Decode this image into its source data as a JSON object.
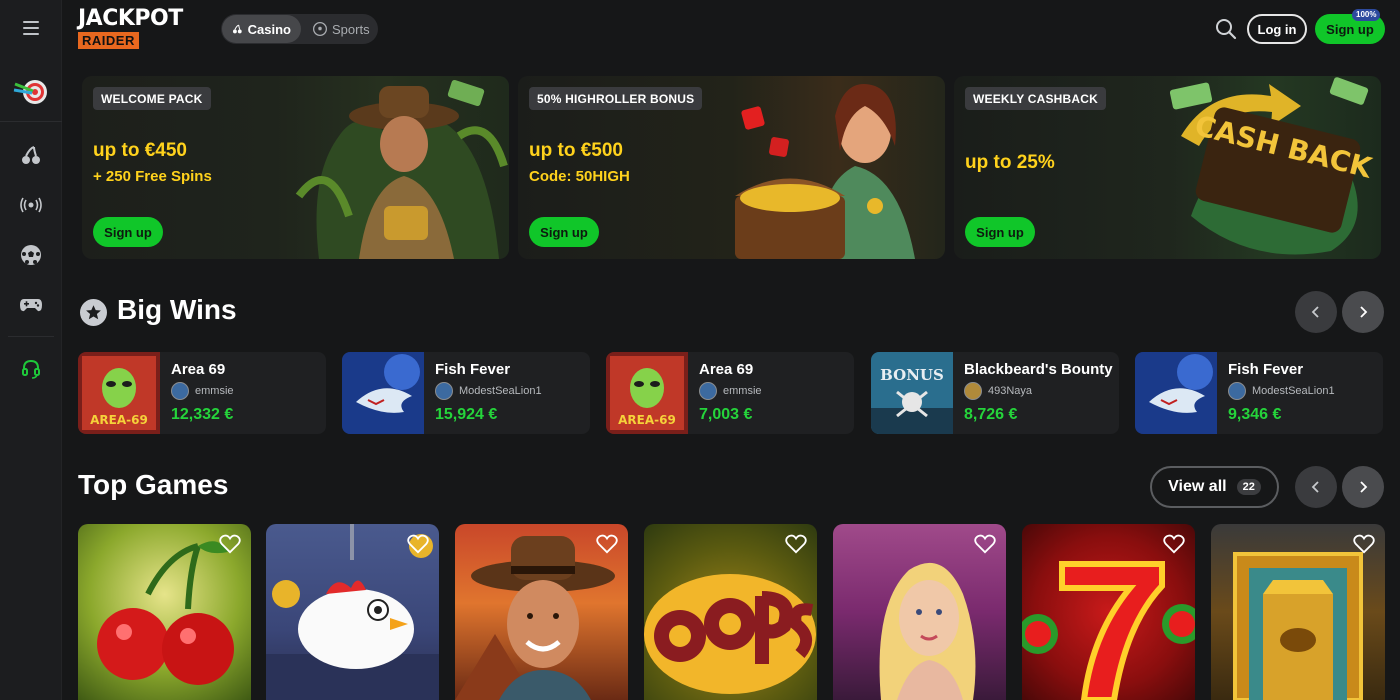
{
  "header": {
    "logo_top": "JACKPOT",
    "logo_bottom": "RAIDER",
    "tabs": [
      {
        "label": "Casino"
      },
      {
        "label": "Sports"
      }
    ],
    "login_label": "Log in",
    "signup_label": "Sign up",
    "signup_badge": "100%"
  },
  "sidebar": {
    "items": [
      "darts-target-icon",
      "cherries-icon",
      "live-broadcast-icon",
      "soccer-ball-icon",
      "gamepad-icon",
      "support-headset-icon"
    ]
  },
  "promos": [
    {
      "tag": "WELCOME PACK",
      "amount": "up to €450",
      "sub": "+ 250 Free Spins",
      "button": "Sign up"
    },
    {
      "tag": "50% HIGHROLLER BONUS",
      "amount": "up to €500",
      "sub": "Code: 50HIGH",
      "button": "Sign up"
    },
    {
      "tag": "WEEKLY CASHBACK",
      "amount": "up to 25%",
      "sub": "",
      "button": "Sign up"
    }
  ],
  "big_wins": {
    "title": "Big Wins",
    "items": [
      {
        "game": "Area 69",
        "user": "emmsie",
        "amount": "12,332 €",
        "thumb_text": "AREA-69"
      },
      {
        "game": "Fish Fever",
        "user": "ModestSeaLion1",
        "amount": "15,924 €",
        "thumb_text": ""
      },
      {
        "game": "Area 69",
        "user": "emmsie",
        "amount": "7,003 €",
        "thumb_text": "AREA-69"
      },
      {
        "game": "Blackbeard's Bounty",
        "user": "493Naya",
        "amount": "8,726 €",
        "thumb_text": "BONUS"
      },
      {
        "game": "Fish Fever",
        "user": "ModestSeaLion1",
        "amount": "9,346 €",
        "thumb_text": ""
      }
    ]
  },
  "top_games": {
    "title": "Top Games",
    "view_all": "View all",
    "count": "22",
    "cards": [
      {
        "name": "cherries"
      },
      {
        "name": "chicken"
      },
      {
        "name": "explorer"
      },
      {
        "name": "oops"
      },
      {
        "name": "lady"
      },
      {
        "name": "sevens"
      },
      {
        "name": "temple"
      }
    ]
  },
  "promo_art": {
    "cashback_text": "CASH BACK"
  },
  "colors": {
    "accent_green": "#10c629",
    "promo_yellow": "#ffd21c",
    "win_green": "#25d43b",
    "logo_orange": "#e8681f"
  }
}
